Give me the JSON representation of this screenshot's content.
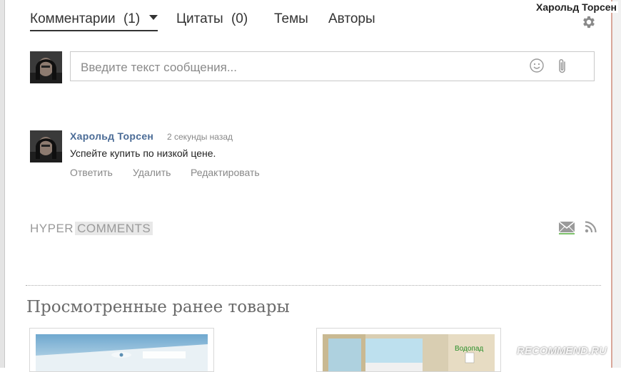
{
  "header": {
    "user_name": "Харольд Торсен",
    "settings_icon": "gear-icon"
  },
  "tabs": [
    {
      "label": "Комментарии",
      "count": "(1)",
      "active": true
    },
    {
      "label": "Цитаты",
      "count": "(0)",
      "active": false
    },
    {
      "label": "Темы",
      "count": "",
      "active": false
    },
    {
      "label": "Авторы",
      "count": "",
      "active": false
    }
  ],
  "composer": {
    "placeholder": "Введите текст сообщения...",
    "emoji_icon": "smile-icon",
    "attach_icon": "paperclip-icon"
  },
  "comment": {
    "author": "Харольд Торсен",
    "time": "2 секунды назад",
    "text": "Успейте купить по низкой цене.",
    "actions": [
      "Ответить",
      "Удалить",
      "Редактировать"
    ]
  },
  "footer": {
    "logo_part1": "HYPER",
    "logo_part2": "COMMENTS",
    "mail_icon": "mail-icon",
    "rss_icon": "rss-icon"
  },
  "viewed": {
    "title": "Просмотренные ранее товары",
    "product2_caption": "Водопад"
  },
  "watermark": "RECOMMEND.RU",
  "colors": {
    "author_link": "#4a6b96",
    "muted_text": "#888888",
    "right_border_accent": "#d9a79a"
  }
}
